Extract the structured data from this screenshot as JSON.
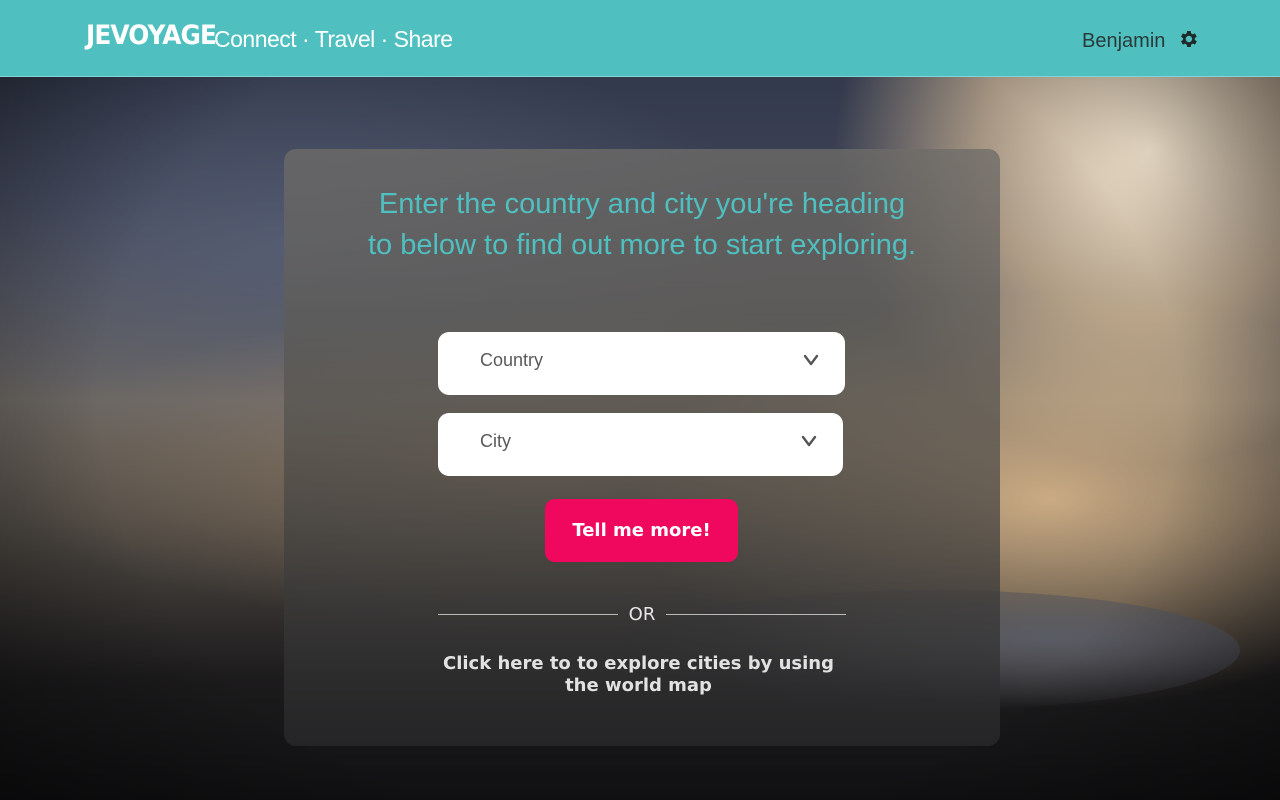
{
  "header": {
    "brand": "JEVOYAGE",
    "tagline": "Connect · Travel · Share",
    "username": "Benjamin",
    "settings_icon": "gear-icon",
    "background_color": "#4fbfbf"
  },
  "main": {
    "headline": "Enter the country and city you're heading to below to find out more to start exploring.",
    "country_select": {
      "placeholder": "Country",
      "icon": "chevron-down-icon"
    },
    "city_select": {
      "placeholder": "City",
      "icon": "chevron-down-icon"
    },
    "submit_label": "Tell me more!",
    "divider_text": "OR",
    "map_link": "Click here to to explore cities by using the world map"
  },
  "colors": {
    "accent": "#4fbfbf",
    "button": "#f0085e",
    "headline": "#4fbfbf"
  }
}
